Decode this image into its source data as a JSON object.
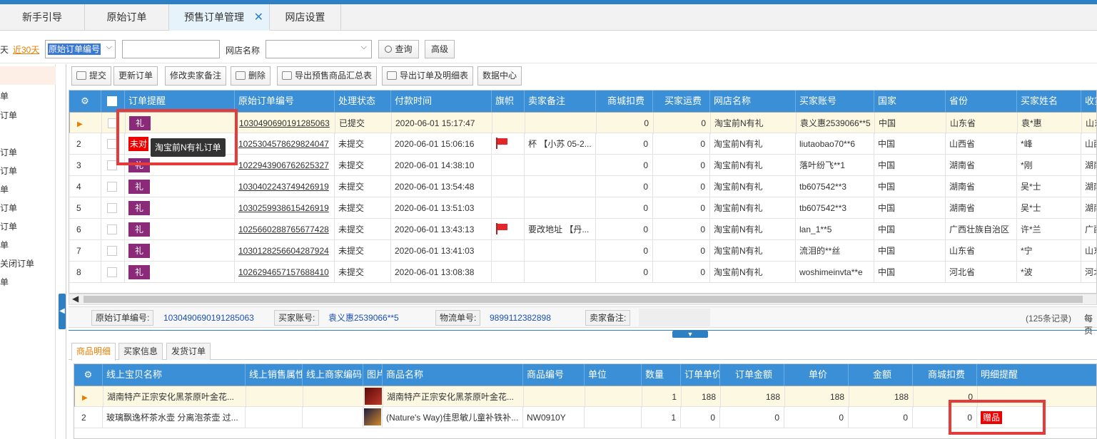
{
  "tabs": [
    {
      "label": "新手引导"
    },
    {
      "label": "原始订单"
    },
    {
      "label": "预售订单管理"
    },
    {
      "label": "网店设置"
    }
  ],
  "filter": {
    "day_suffix": "天",
    "last30": "近30天",
    "field_select": "原始订单编号",
    "field_input": "",
    "shop_label": "网店名称",
    "shop_select": "",
    "query": "查询",
    "advanced": "高级"
  },
  "leftnav": [
    "单",
    "订单",
    "订单",
    "订单",
    "单",
    "订单",
    "订单",
    "单",
    "关闭订单",
    "单"
  ],
  "toolbar": {
    "submit": "提交",
    "update": "更新订单",
    "edit_note": "修改卖家备注",
    "delete": "删除",
    "export_summary": "导出预售商品汇总表",
    "export_detail": "导出订单及明细表",
    "data_center": "数据中心"
  },
  "grid": {
    "headers": [
      "订单提醒",
      "原始订单编号",
      "处理状态",
      "付款时间",
      "旗帜",
      "卖家备注",
      "商城扣费",
      "买家运费",
      "网店名称",
      "买家账号",
      "国家",
      "省份",
      "买家姓名",
      "收货"
    ],
    "rows": [
      {
        "idx": "",
        "tag": "礼",
        "order": "1030490690191285063",
        "status": "已提交",
        "time": "2020-06-01 15:17:47",
        "flag": false,
        "note": "",
        "fee": "0",
        "ship": "0",
        "shop": "淘宝前N有礼",
        "buyer": "袁义惠2539066**5",
        "country": "中国",
        "prov": "山东省",
        "name": "袁*惠",
        "addr": "山东"
      },
      {
        "idx": "2",
        "tag": "未对",
        "order": "1025304578629824047",
        "status": "未提交",
        "time": "2020-06-01 15:06:16",
        "flag": true,
        "note": "杯 【小苏 05-2...",
        "fee": "0",
        "ship": "0",
        "shop": "淘宝前N有礼",
        "buyer": "liutaobao70**6",
        "country": "中国",
        "prov": "山西省",
        "name": "*峰",
        "addr": "山西"
      },
      {
        "idx": "3",
        "tag": "礼",
        "order": "1022943906762625327",
        "status": "未提交",
        "time": "2020-06-01 14:38:10",
        "flag": false,
        "note": "",
        "fee": "0",
        "ship": "0",
        "shop": "淘宝前N有礼",
        "buyer": "落叶纷飞**1",
        "country": "中国",
        "prov": "湖南省",
        "name": "*刚",
        "addr": "湖南"
      },
      {
        "idx": "4",
        "tag": "礼",
        "order": "1030402243749426919",
        "status": "未提交",
        "time": "2020-06-01 13:54:48",
        "flag": false,
        "note": "",
        "fee": "0",
        "ship": "0",
        "shop": "淘宝前N有礼",
        "buyer": "tb607542**3",
        "country": "中国",
        "prov": "湖南省",
        "name": "吴*士",
        "addr": "湖南"
      },
      {
        "idx": "5",
        "tag": "礼",
        "order": "1030259938615426919",
        "status": "未提交",
        "time": "2020-06-01 13:51:03",
        "flag": false,
        "note": "",
        "fee": "0",
        "ship": "0",
        "shop": "淘宝前N有礼",
        "buyer": "tb607542**3",
        "country": "中国",
        "prov": "湖南省",
        "name": "吴*士",
        "addr": "湖南"
      },
      {
        "idx": "6",
        "tag": "礼",
        "order": "1025660288765677428",
        "status": "未提交",
        "time": "2020-06-01 13:43:13",
        "flag": true,
        "note": "要改地址 【丹...",
        "fee": "0",
        "ship": "0",
        "shop": "淘宝前N有礼",
        "buyer": "lan_1**5",
        "country": "中国",
        "prov": "广西壮族自治区",
        "name": "许*兰",
        "addr": "广西"
      },
      {
        "idx": "7",
        "tag": "礼",
        "order": "1030128256604287924",
        "status": "未提交",
        "time": "2020-06-01 13:41:03",
        "flag": false,
        "note": "",
        "fee": "0",
        "ship": "0",
        "shop": "淘宝前N有礼",
        "buyer": "流泪的**丝",
        "country": "中国",
        "prov": "山东省",
        "name": "*宁",
        "addr": "山东"
      },
      {
        "idx": "8",
        "tag": "礼",
        "order": "1026294657157688410",
        "status": "未提交",
        "time": "2020-06-01 13:08:38",
        "flag": false,
        "note": "",
        "fee": "0",
        "ship": "0",
        "shop": "淘宝前N有礼",
        "buyer": "woshimeinvta**e",
        "country": "中国",
        "prov": "河北省",
        "name": "*波",
        "addr": "河北"
      }
    ],
    "tooltip": "淘宝前N有礼订单"
  },
  "info": {
    "order_label": "原始订单编号:",
    "order_value": "1030490690191285063",
    "buyer_label": "买家账号:",
    "buyer_value": "袁义惠2539066**5",
    "logi_label": "物流单号:",
    "logi_value": "9899112382898",
    "note_label": "卖家备注:",
    "count": "(125条记录)",
    "per_page": "每页"
  },
  "subtabs": [
    "商品明细",
    "买家信息",
    "发货订单"
  ],
  "detail": {
    "headers": [
      "线上宝贝名称",
      "线上销售属性",
      "线上商家编码",
      "图片",
      "商品名称",
      "商品编号",
      "单位",
      "数量",
      "订单单价",
      "订单金额",
      "单价",
      "金额",
      "商城扣费",
      "明细提醒"
    ],
    "rows": [
      {
        "idx": "",
        "online": "湖南特产正宗安化黑茶原叶金花...",
        "name": "湖南特产正宗安化黑茶原叶金花...",
        "code": "",
        "qty": "1",
        "oprice": "188",
        "oamt": "188",
        "price": "188",
        "amt": "188",
        "fee": "0",
        "remind": ""
      },
      {
        "idx": "2",
        "online": "玻璃飘逸杯茶水壶 分离泡茶壶 过...",
        "name": "(Nature's Way)佳思敏儿童补铁补...",
        "code": "NW0910Y",
        "qty": "1",
        "oprice": "0",
        "oamt": "0",
        "price": "0",
        "amt": "0",
        "fee": "0",
        "remind": "赠品"
      }
    ]
  }
}
